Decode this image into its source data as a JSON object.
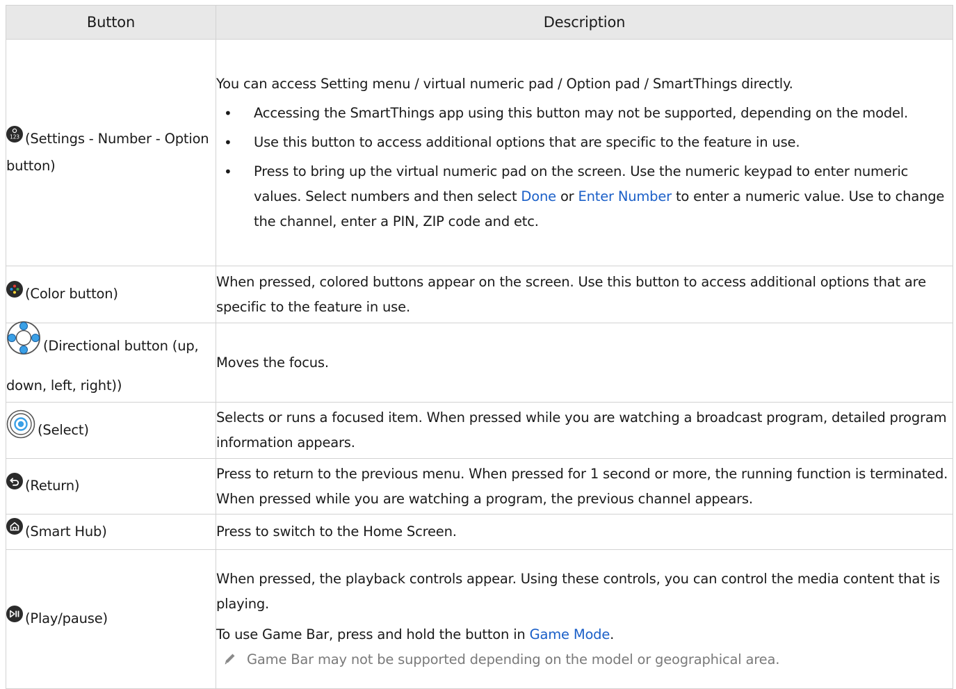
{
  "table": {
    "headers": {
      "button": "Button",
      "description": "Description"
    },
    "rows": [
      {
        "button": "(Settings - Number - Option button)",
        "icon": "settings-number-option-icon",
        "intro": "You can access Setting menu / virtual numeric pad / Option pad / SmartThings directly.",
        "bullets": [
          "Accessing the SmartThings app using this button may not be supported, depending on the model.",
          "Use this button to access additional options that are specific to the feature in use."
        ],
        "bullet3": {
          "t1": "Press to bring up the virtual numeric pad on the screen. Use the numeric keypad to enter numeric values. Select numbers and then select",
          "link1": "Done",
          "t2": "or",
          "link2": "Enter Number",
          "t3": "to enter a numeric value. Use to change the channel, enter a PIN, ZIP code and etc."
        }
      },
      {
        "button": "(Color button)",
        "icon": "color-button-icon",
        "description": "When pressed, colored buttons appear on the screen. Use this button to access additional options that are specific to the feature in use."
      },
      {
        "button": "(Directional button (up, down, left, right))",
        "icon": "directional-pad-icon",
        "description": "Moves the focus."
      },
      {
        "button": "(Select)",
        "icon": "select-icon",
        "description": "Selects or runs a focused item. When pressed while you are watching a broadcast program, detailed program information appears."
      },
      {
        "button": "(Return)",
        "icon": "return-icon",
        "description": "Press to return to the previous menu. When pressed for 1 second or more, the running function is terminated. When pressed while you are watching a program, the previous channel appears."
      },
      {
        "button": "(Smart Hub)",
        "icon": "home-icon",
        "description": "Press to switch to the Home Screen."
      },
      {
        "button": "(Play/pause)",
        "icon": "play-pause-icon",
        "description": "When pressed, the playback controls appear. Using these controls, you can control the media content that is playing.",
        "line2_before": "To use Game Bar, press and hold the button in",
        "line2_link": "Game Mode",
        "line2_after": ".",
        "note_icon": "pencil-note-icon",
        "note": "Game Bar may not be supported depending on the model or geographical area."
      }
    ]
  },
  "colors": {
    "link": "#1a5fc8",
    "header_bg": "#e8e8e8",
    "icon_dark": "#2b2b2b",
    "directional_blue": "#3aa0e6"
  }
}
